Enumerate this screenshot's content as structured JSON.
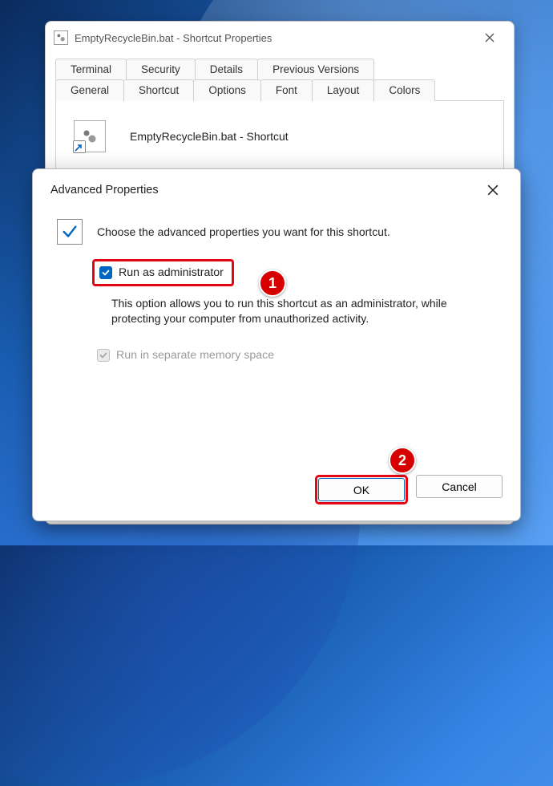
{
  "parentWindow": {
    "title": "EmptyRecycleBin.bat - Shortcut Properties",
    "tabsTop": [
      "Terminal",
      "Security",
      "Details",
      "Previous Versions"
    ],
    "tabsBottom": [
      "General",
      "Shortcut",
      "Options",
      "Font",
      "Layout",
      "Colors"
    ],
    "activeTab": "Shortcut",
    "shortcutName": "EmptyRecycleBin.bat - Shortcut"
  },
  "dialog": {
    "title": "Advanced Properties",
    "intro": "Choose the advanced properties you want for this shortcut.",
    "opt1": {
      "label": "Run as administrator",
      "checked": true,
      "desc": "This option allows you to run this shortcut as an administrator, while protecting your computer from unauthorized activity."
    },
    "opt2": {
      "label": "Run in separate memory space",
      "checked": true,
      "enabled": false
    },
    "ok": "OK",
    "cancel": "Cancel"
  },
  "callouts": {
    "one": "1",
    "two": "2"
  }
}
